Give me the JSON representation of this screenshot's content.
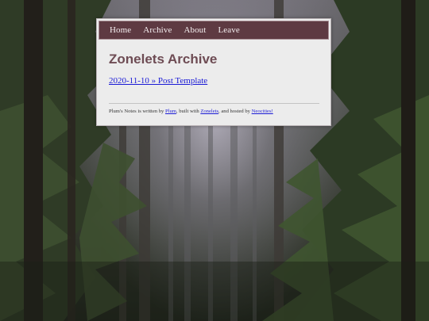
{
  "nav": {
    "items": [
      {
        "label": "Home"
      },
      {
        "label": "Archive"
      },
      {
        "label": "About"
      },
      {
        "label": "Leave"
      }
    ]
  },
  "page": {
    "title": "Zonelets Archive",
    "post_link": "2020-11-10 » Post Template"
  },
  "footer": {
    "prefix": "Plum's Notes is written by ",
    "author_link": "Plum",
    "mid1": ", built with ",
    "builder_link": "Zonelets",
    "mid2": ", and hosted by ",
    "host_link": "Neocities!"
  },
  "colors": {
    "nav_bg": "#5e3a42",
    "title": "#6e4c54",
    "link": "#1b1bd6",
    "card_bg": "#ececec"
  }
}
